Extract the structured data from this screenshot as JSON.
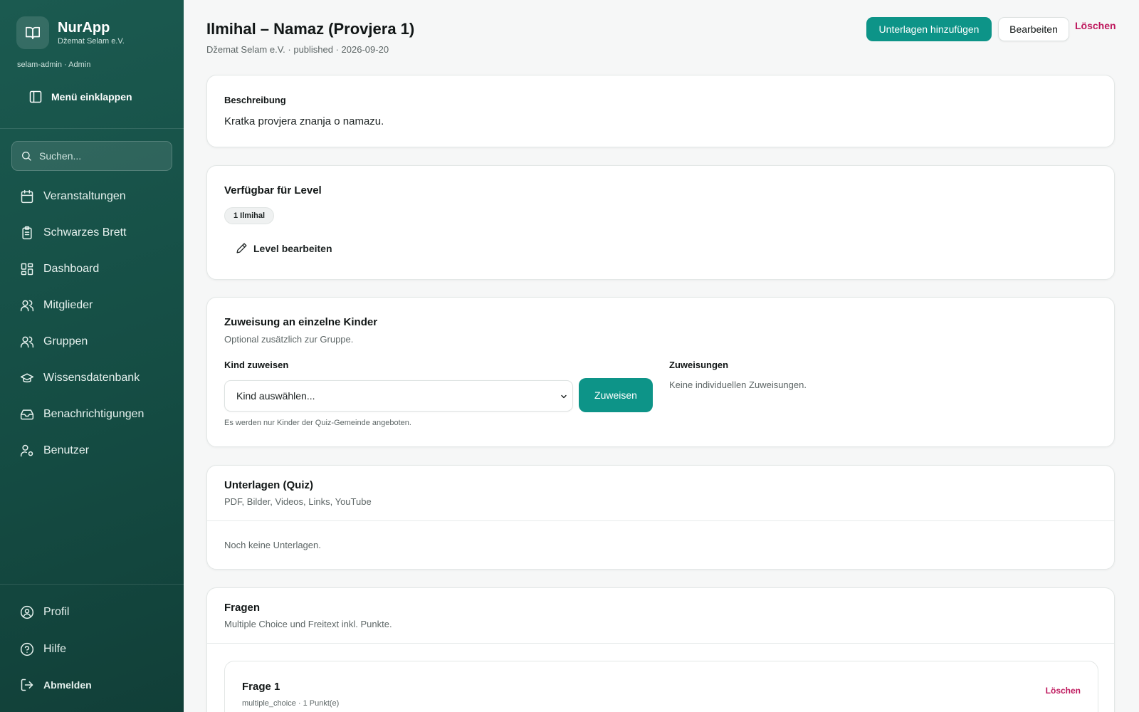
{
  "app": {
    "name": "NurApp",
    "org": "Džemat Selam e.V.",
    "user_line": "selam-admin · Admin"
  },
  "sidebar": {
    "collapse_label": "Menü einklappen",
    "search_placeholder": "Suchen...",
    "items": [
      {
        "label": "Veranstaltungen",
        "icon": "calendar-icon"
      },
      {
        "label": "Schwarzes Brett",
        "icon": "clipboard-icon"
      },
      {
        "label": "Dashboard",
        "icon": "grid-icon"
      },
      {
        "label": "Mitglieder",
        "icon": "users-icon"
      },
      {
        "label": "Gruppen",
        "icon": "users-icon"
      },
      {
        "label": "Wissensdatenbank",
        "icon": "graduation-cap-icon"
      },
      {
        "label": "Benachrichtigungen",
        "icon": "inbox-icon"
      },
      {
        "label": "Benutzer",
        "icon": "user-cog-icon"
      }
    ],
    "bottom": [
      {
        "label": "Profil",
        "icon": "user-circle-icon"
      },
      {
        "label": "Hilfe",
        "icon": "help-circle-icon"
      },
      {
        "label": "Abmelden",
        "icon": "logout-icon"
      }
    ]
  },
  "header": {
    "title": "Ilmihal – Namaz (Provjera 1)",
    "meta": "Džemat Selam e.V. · published · 2026-09-20",
    "add_materials": "Unterlagen hinzufügen",
    "edit": "Bearbeiten",
    "delete": "Löschen"
  },
  "description": {
    "heading": "Beschreibung",
    "text": "Kratka provjera znanja o namazu."
  },
  "levels": {
    "heading": "Verfügbar für Level",
    "pill": "1 Ilmihal",
    "edit_label": "Level bearbeiten"
  },
  "assignment": {
    "heading": "Zuweisung an einzelne Kinder",
    "sub": "Optional zusätzlich zur Gruppe.",
    "kind_label": "Kind zuweisen",
    "select_value": "Kind auswählen...",
    "assign_button": "Zuweisen",
    "hint": "Es werden nur Kinder der Quiz-Gemeinde angeboten.",
    "list_label": "Zuweisungen",
    "empty": "Keine individuellen Zuweisungen."
  },
  "materials": {
    "heading": "Unterlagen (Quiz)",
    "sub": "PDF, Bilder, Videos, Links, YouTube",
    "empty": "Noch keine Unterlagen."
  },
  "questions": {
    "heading": "Fragen",
    "sub": "Multiple Choice und Freitext inkl. Punkte.",
    "items": [
      {
        "title": "Frage 1",
        "meta": "multiple_choice · 1 Punkt(e)",
        "delete": "Löschen"
      }
    ]
  },
  "colors": {
    "sidebar": "#154d44",
    "accent": "#0d9488",
    "danger": "#be185d"
  }
}
